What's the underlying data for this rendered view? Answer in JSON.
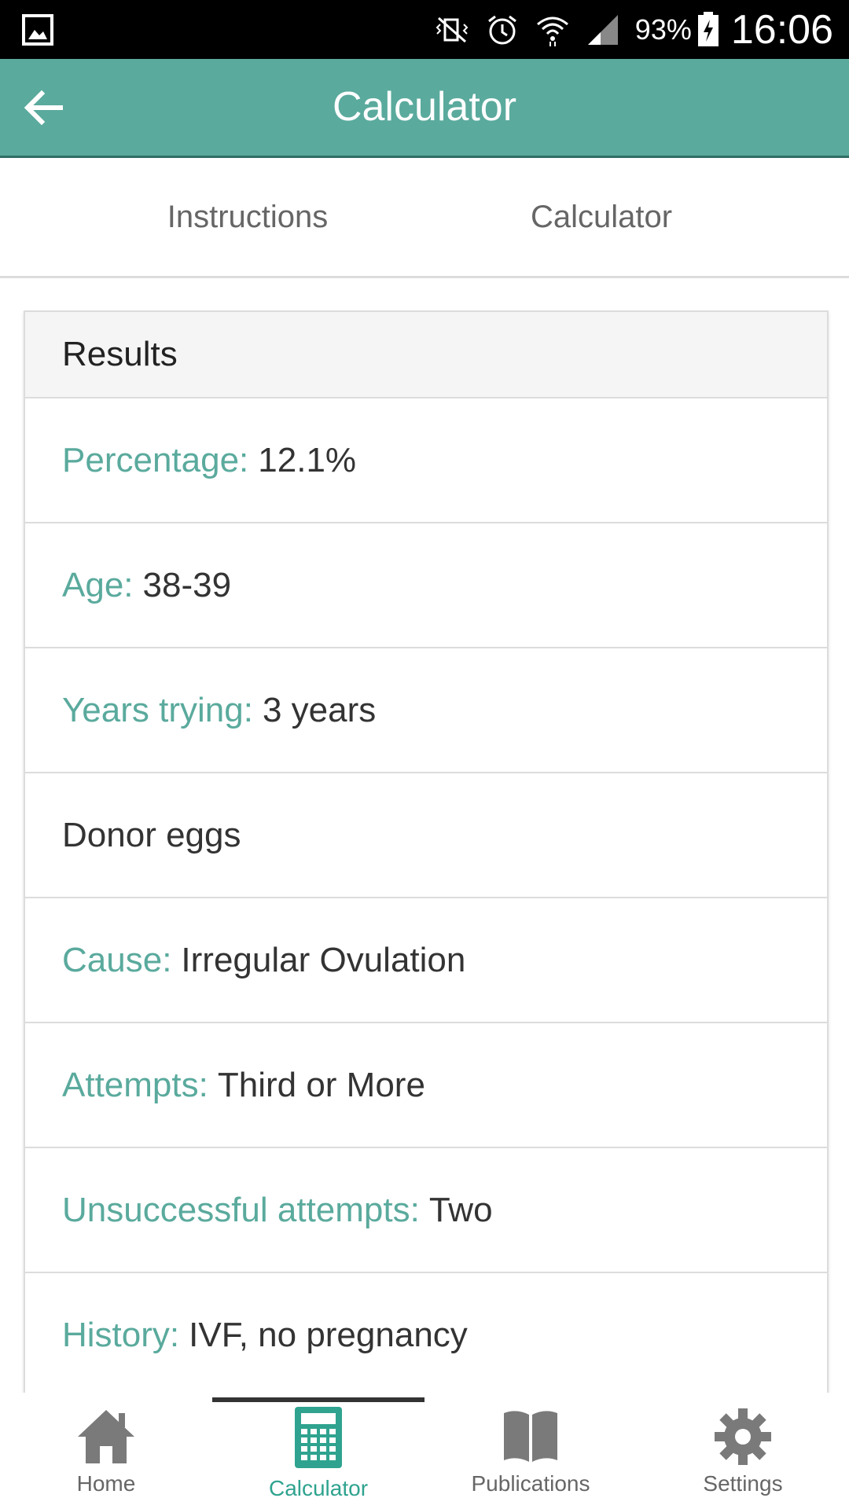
{
  "status_bar": {
    "battery_percent": "93%",
    "time": "16:06"
  },
  "app_bar": {
    "title": "Calculator"
  },
  "tabs": [
    {
      "label": "Instructions"
    },
    {
      "label": "Calculator"
    }
  ],
  "results": {
    "header": "Results",
    "rows": [
      {
        "label": "Percentage:",
        "value": "12.1%"
      },
      {
        "label": "Age:",
        "value": "38-39"
      },
      {
        "label": "Years trying:",
        "value": "3 years"
      },
      {
        "label": "",
        "value": "Donor eggs"
      },
      {
        "label": "Cause:",
        "value": "Irregular Ovulation"
      },
      {
        "label": "Attempts:",
        "value": "Third or More"
      },
      {
        "label": "Unsuccessful attempts:",
        "value": "Two"
      },
      {
        "label": "History:",
        "value": "IVF, no pregnancy"
      }
    ]
  },
  "bottom_nav": {
    "items": [
      {
        "label": "Home",
        "icon": "home-icon"
      },
      {
        "label": "Calculator",
        "icon": "calculator-icon",
        "active": true
      },
      {
        "label": "Publications",
        "icon": "book-icon"
      },
      {
        "label": "Settings",
        "icon": "gear-icon"
      }
    ]
  },
  "colors": {
    "accent": "#5aaa9d",
    "active_nav": "#2fa38f"
  }
}
